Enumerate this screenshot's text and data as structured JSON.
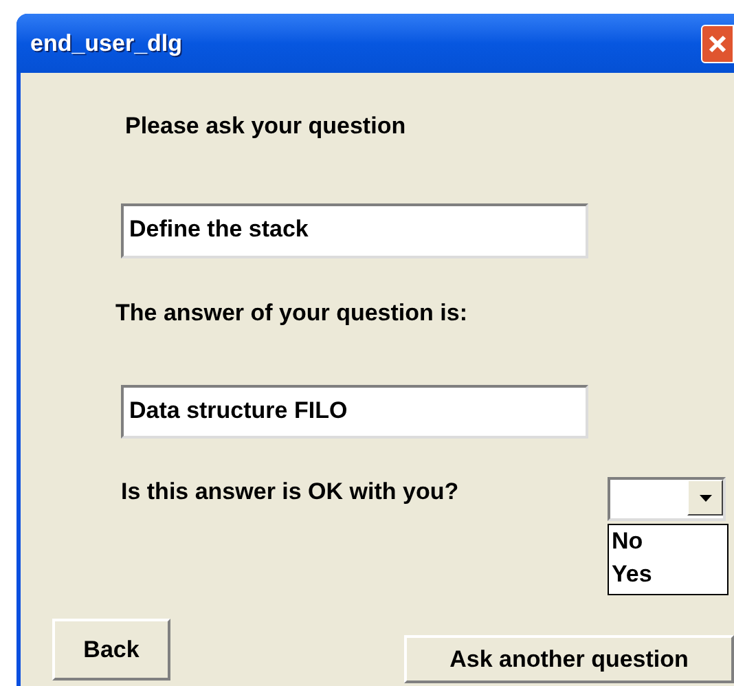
{
  "window": {
    "title": "end_user_dlg"
  },
  "question_label": "Please ask your question",
  "question_field": {
    "value": "Define the stack"
  },
  "answer_label": "The answer of your question is:",
  "answer_field": {
    "value": "Data structure FILO"
  },
  "feedback_label": "Is this answer is OK with you?",
  "feedback_dropdown": {
    "expanded": true,
    "options": [
      {
        "label": "No",
        "selected": false
      },
      {
        "label": "Yes",
        "selected": false
      }
    ]
  },
  "buttons": [
    {
      "label": "Back"
    },
    {
      "label": "Ask another question"
    }
  ]
}
